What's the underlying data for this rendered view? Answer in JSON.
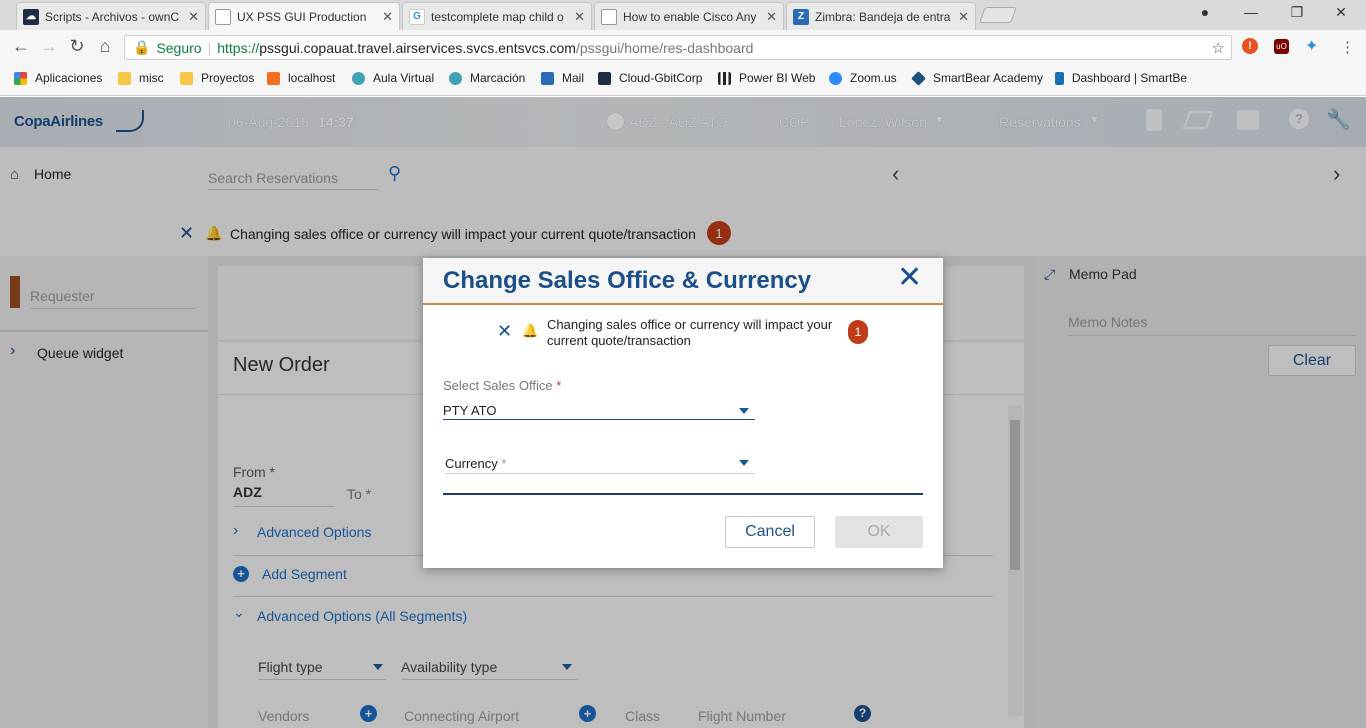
{
  "browser": {
    "tabs": [
      {
        "title": "Scripts - Archivos - ownC",
        "favicon": "cloud-icon"
      },
      {
        "title": "UX PSS GUI Production",
        "favicon": "page-icon"
      },
      {
        "title": "testcomplete map child o",
        "favicon": "google-icon"
      },
      {
        "title": "How to enable Cisco Any",
        "favicon": "page-icon"
      },
      {
        "title": "Zimbra: Bandeja de entra",
        "favicon": "zimbra-icon"
      }
    ],
    "secure_label": "Seguro",
    "url_prefix": "https://",
    "url_host": "pssgui.copauat.travel.airservices.svcs.entsvcs.com",
    "url_path": "/pssgui/home/res-dashboard",
    "bookmarks": [
      {
        "label": "Aplicaciones",
        "icon": "apps-grid-icon"
      },
      {
        "label": "misc",
        "icon": "folder-icon"
      },
      {
        "label": "Proyectos",
        "icon": "folder-icon"
      },
      {
        "label": "localhost",
        "icon": "xampp-icon"
      },
      {
        "label": "Aula Virtual",
        "icon": "globe-icon"
      },
      {
        "label": "Marcación",
        "icon": "globe-icon"
      },
      {
        "label": "Mail",
        "icon": "zimbra-icon"
      },
      {
        "label": "Cloud-GbitCorp",
        "icon": "cloud-icon"
      },
      {
        "label": "Power BI Web",
        "icon": "chart-icon"
      },
      {
        "label": "Zoom.us",
        "icon": "zoom-icon"
      },
      {
        "label": "SmartBear Academy",
        "icon": "smartbear-icon"
      },
      {
        "label": "Dashboard | SmartBe",
        "icon": "page-icon"
      }
    ]
  },
  "app": {
    "logo": "CopaAirlines",
    "date": "06-Aug-2018",
    "time": "14:37",
    "location": "ADZ - ADZ ATO",
    "currency": "COP",
    "user": "Lopez, Wilson",
    "module": "Reservations",
    "home_label": "Home",
    "search_placeholder": "Search Reservations",
    "banner_text": "Changing sales office or currency will impact your current quote/transaction",
    "banner_count": "1",
    "requester_placeholder": "Requester",
    "queue_widget": "Queue widget",
    "new_order": "New Order",
    "from_label": "From *",
    "from_value": "ADZ",
    "to_label": "To *",
    "advanced_options": "Advanced Options",
    "add_segment": "Add Segment",
    "advanced_all": "Advanced Options (All Segments)",
    "flight_type": "Flight type",
    "availability_type": "Availability type",
    "vendors": "Vendors",
    "connecting_airport": "Connecting Airport",
    "class": "Class",
    "flight_number": "Flight Number",
    "memo_pad": "Memo Pad",
    "memo_notes": "Memo Notes",
    "clear": "Clear"
  },
  "dialog": {
    "title": "Change Sales Office & Currency",
    "warning": "Changing sales office or currency will impact your current quote/transaction",
    "warning_count": "1",
    "sales_office_label": "Select Sales Office",
    "sales_office_value": "PTY ATO",
    "currency_label": "Currency",
    "required_mark": "*",
    "cancel": "Cancel",
    "ok": "OK"
  },
  "colors": {
    "brand_blue": "#1b4f8a",
    "accent_orange": "#c98a4b",
    "badge_red": "#bf3d17"
  }
}
